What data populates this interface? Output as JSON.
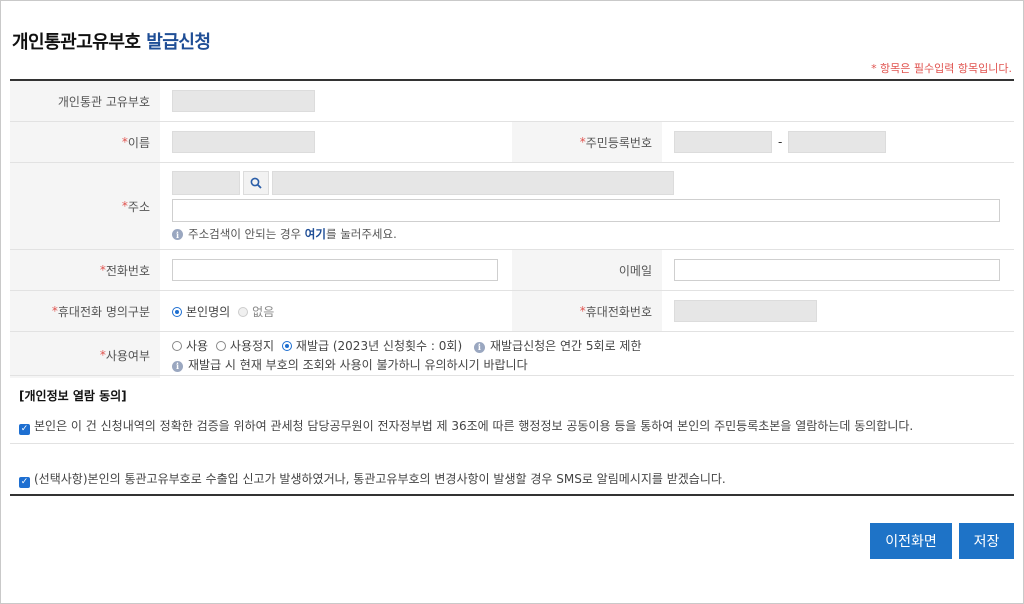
{
  "header": {
    "title_main": "개인통관고유부호",
    "title_accent": "발급신청",
    "required_note": "* 항목은 필수입력 항목입니다."
  },
  "form": {
    "customs_code_label": "개인통관 고유부호",
    "name_label": "이름",
    "rrn_label": "주민등록번호",
    "rrn_separator": "-",
    "address_label": "주소",
    "address_help_prefix": "주소검색이 안되는 경우",
    "address_help_link": "여기",
    "address_help_suffix": "를 눌러주세요.",
    "phone_label": "전화번호",
    "email_label": "이메일",
    "mobile_owner_label": "휴대전화 명의구분",
    "mobile_owner_options": [
      "본인명의",
      "없음"
    ],
    "mobile_owner_selected": "본인명의",
    "mobile_label": "휴대전화번호",
    "usage_label": "사용여부",
    "usage_options": [
      "사용",
      "사용정지",
      "재발급 (2023년 신청횟수 : 0회)"
    ],
    "usage_selected": "재발급",
    "usage_info": "재발급신청은 연간 5회로 제한",
    "usage_warning": "재발급 시 현재 부호의 조회와 사용이 불가하니 유의하시기 바랍니다"
  },
  "consent": {
    "section_title": "[개인정보 열람 동의]",
    "item1": "본인은 이 건 신청내역의 정확한 검증을 위하여 관세청 담당공무원이 전자정부법 제 36조에 따른 행정정보 공동이용 등을 통하여 본인의 주민등록초본을 열람하는데 동의합니다.",
    "item1_checked": true,
    "item2": "(선택사항)본인의 통관고유부호로 수출입 신고가 발생하였거나, 통관고유부호의 변경사항이 발생할 경우 SMS로 알림메시지를 받겠습니다.",
    "item2_checked": true
  },
  "buttons": {
    "prev": "이전화면",
    "save": "저장"
  },
  "colors": {
    "accent": "#1f4e96",
    "button": "#1e73c7",
    "required": "#e0534f"
  }
}
